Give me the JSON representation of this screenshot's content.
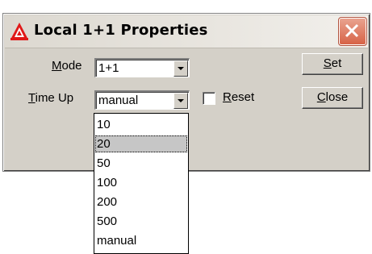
{
  "window": {
    "title": "Local 1+1 Properties"
  },
  "icons": {
    "app": "triangle-a-logo-icon",
    "close": "close-x-icon"
  },
  "colors": {
    "close_button": "#d76347",
    "title_bar": "#e9e6e0",
    "dialog_face": "#d4d0c8",
    "selection": "#c6c6c6"
  },
  "form": {
    "mode": {
      "label_access": "M",
      "label_rest": "ode",
      "value": "1+1"
    },
    "time_up": {
      "label_access": "T",
      "label_rest": "ime Up",
      "value": "manual"
    },
    "reset": {
      "label_access": "R",
      "label_rest": "eset",
      "checked": false
    }
  },
  "buttons": {
    "set": {
      "access": "S",
      "rest": "et"
    },
    "close": {
      "access": "C",
      "rest": "lose"
    }
  },
  "dropdown": {
    "options": [
      "10",
      "20",
      "50",
      "100",
      "200",
      "500",
      "manual"
    ],
    "highlighted": "20"
  }
}
